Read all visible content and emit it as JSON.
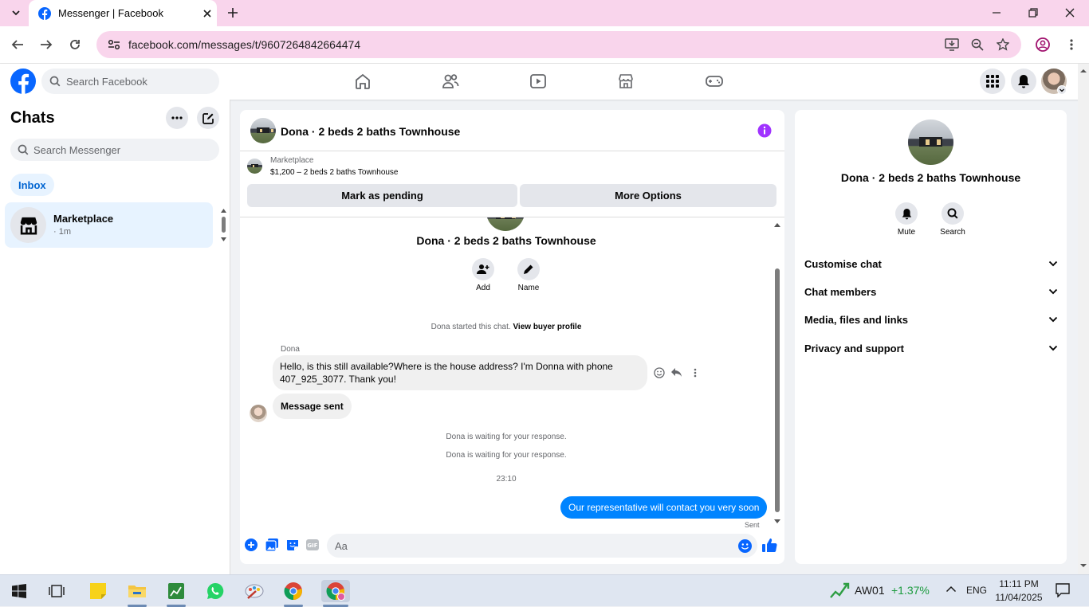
{
  "browser": {
    "tab_title": "Messenger | Facebook",
    "url": "facebook.com/messages/t/9607264842664474",
    "icons": [
      "tab-search-icon",
      "facebook-favicon",
      "close-icon",
      "new-tab-icon",
      "back-icon",
      "forward-icon",
      "reload-icon",
      "site-info-icon",
      "install-app-icon",
      "zoom-icon",
      "bookmark-star-icon",
      "profile-icon",
      "kebab-menu-icon",
      "minimize-icon",
      "restore-icon",
      "window-close-icon"
    ]
  },
  "fb_header": {
    "search_placeholder": "Search Facebook",
    "nav_icons": [
      "home-icon",
      "friends-icon",
      "watch-icon",
      "marketplace-icon",
      "gaming-icon"
    ],
    "right_icons": [
      "menu-grid-icon",
      "notifications-icon",
      "account-avatar"
    ]
  },
  "sidebar": {
    "title": "Chats",
    "search_placeholder": "Search Messenger",
    "filter": "Inbox",
    "chats": [
      {
        "name": "Marketplace",
        "meta": "· 1m"
      }
    ]
  },
  "conversation": {
    "title": "Dona · 2 beds 2 baths Townhouse",
    "marketplace": {
      "label": "Marketplace",
      "listing": "$1,200 – 2 beds 2 baths Townhouse",
      "pending_button": "Mark as pending",
      "options_button": "More Options"
    },
    "intro": {
      "title": "Dona · 2 beds 2 baths Townhouse",
      "add_label": "Add",
      "name_label": "Name"
    },
    "started_text": "Dona started this chat.",
    "buyer_link": "View buyer profile",
    "sender_name": "Dona",
    "messages": [
      {
        "from": "Dona",
        "text_line1": "Hello, is this still available?Where is the house address? I'm Donna with phone",
        "text_line2": "407_925_3077.  Thank you!"
      },
      {
        "from": "Dona",
        "text": "Message sent"
      },
      {
        "from": "me",
        "text": "Our representative will contact you very soon",
        "status": "Sent"
      }
    ],
    "system_1": "Dona is waiting for your response.",
    "system_2": "Dona is waiting for your response.",
    "time": "23:10",
    "composer_placeholder": "Aa"
  },
  "right_panel": {
    "title": "Dona · 2 beds 2 baths Townhouse",
    "mute_label": "Mute",
    "search_label": "Search",
    "sections": [
      "Customise chat",
      "Chat members",
      "Media, files and links",
      "Privacy and support"
    ]
  },
  "taskbar": {
    "ticker": "AW01",
    "change": "+1.37%",
    "lang": "ENG",
    "time": "11:11 PM",
    "date": "11/04/2025",
    "colors": {
      "ticker_change": "#1c9b3e",
      "accent": "#0084ff",
      "brand": "#0866ff"
    }
  }
}
